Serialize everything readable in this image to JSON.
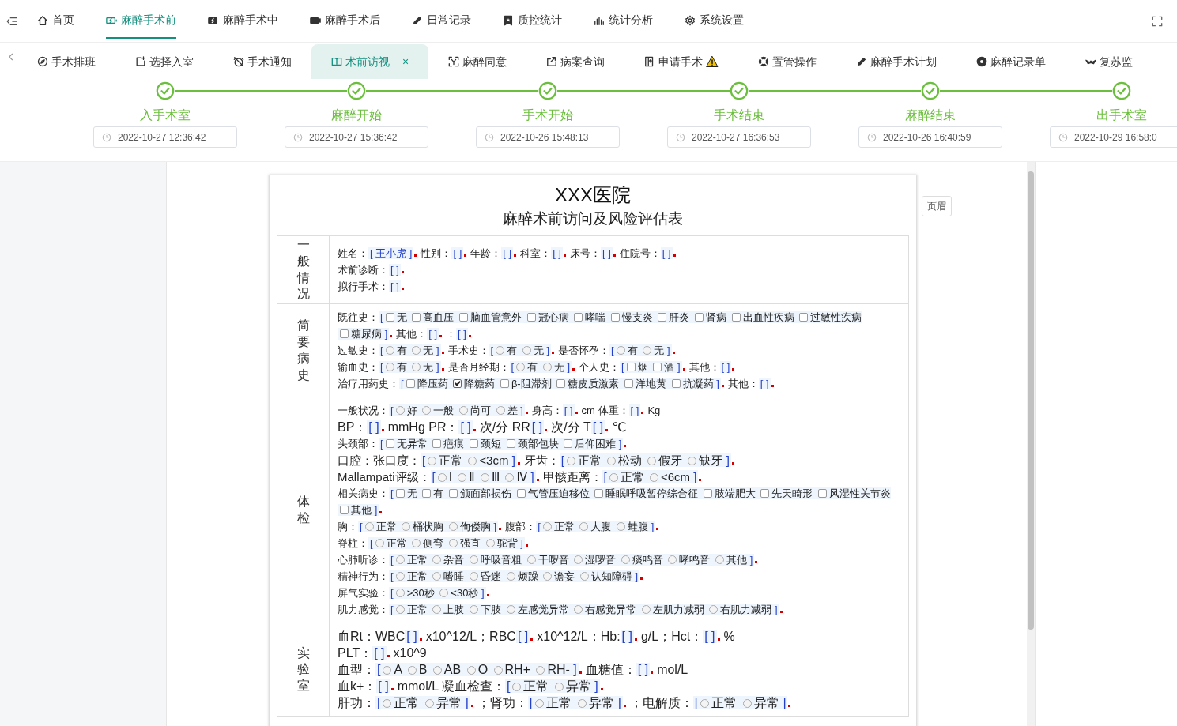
{
  "top_nav": [
    {
      "label": "首页",
      "selected": false
    },
    {
      "label": "麻醉手术前",
      "selected": true
    },
    {
      "label": "麻醉手术中",
      "selected": false
    },
    {
      "label": "麻醉手术后",
      "selected": false
    },
    {
      "label": "日常记录",
      "selected": false
    },
    {
      "label": "质控统计",
      "selected": false
    },
    {
      "label": "统计分析",
      "selected": false
    },
    {
      "label": "系统设置",
      "selected": false
    }
  ],
  "tabs": [
    {
      "label": "手术排班",
      "selected": false,
      "warning": false
    },
    {
      "label": "选择入室",
      "selected": false,
      "warning": false
    },
    {
      "label": "手术通知",
      "selected": false,
      "warning": false
    },
    {
      "label": "术前访视",
      "selected": true,
      "warning": false,
      "close": "×"
    },
    {
      "label": "麻醉同意",
      "selected": false,
      "warning": false
    },
    {
      "label": "病案查询",
      "selected": false,
      "warning": false
    },
    {
      "label": "申请手术",
      "selected": false,
      "warning": true
    },
    {
      "label": "置管操作",
      "selected": false,
      "warning": false
    },
    {
      "label": "麻醉手术计划",
      "selected": false,
      "warning": false
    },
    {
      "label": "麻醉记录单",
      "selected": false,
      "warning": false
    },
    {
      "label": "复苏监",
      "selected": false,
      "warning": false
    }
  ],
  "steps": [
    {
      "label": "入手术室",
      "done": true,
      "time": "2022-10-27 12:36:42"
    },
    {
      "label": "麻醉开始",
      "done": true,
      "time": "2022-10-27 15:36:42"
    },
    {
      "label": "手术开始",
      "done": true,
      "time": "2022-10-26 15:48:13"
    },
    {
      "label": "手术结束",
      "done": true,
      "time": "2022-10-27 16:36:53"
    },
    {
      "label": "麻醉结束",
      "done": true,
      "time": "2022-10-26 16:40:59"
    },
    {
      "label": "出手术室",
      "done": true,
      "time": "2022-10-29 16:58:0"
    }
  ],
  "document": {
    "hospital": "XXX医院",
    "title": "麻醉术前访问及风险评估表",
    "header_button": "页眉",
    "sections": [
      {
        "title": "一般情况",
        "lines": [
          {
            "kind": "small",
            "parts": [
              {
                "kind": "text",
                "text": "姓名："
              },
              {
                "kind": "field",
                "open": "[",
                "value": "王小虎",
                "close": "]"
              },
              {
                "kind": "text",
                "text": "性别："
              },
              {
                "kind": "field",
                "open": "[",
                "close": "]"
              },
              {
                "kind": "text",
                "text": "年龄："
              },
              {
                "kind": "field",
                "open": "[",
                "close": "]"
              },
              {
                "kind": "text",
                "text": "科室："
              },
              {
                "kind": "field",
                "open": "[",
                "close": "]"
              },
              {
                "kind": "text",
                "text": "床号："
              },
              {
                "kind": "field",
                "open": "[",
                "close": "]"
              },
              {
                "kind": "text",
                "text": "住院号："
              },
              {
                "kind": "field",
                "open": "[",
                "close": "]"
              }
            ]
          },
          {
            "kind": "small",
            "parts": [
              {
                "kind": "text",
                "text": "术前诊断："
              },
              {
                "kind": "field",
                "open": "[",
                "close": "]"
              }
            ]
          },
          {
            "kind": "small",
            "parts": [
              {
                "kind": "text",
                "text": "拟行手术："
              },
              {
                "kind": "field",
                "open": "[",
                "close": "]"
              }
            ]
          }
        ]
      },
      {
        "title": "简要病史",
        "lines": [
          {
            "kind": "small",
            "parts": [
              {
                "kind": "text",
                "text": "既往史："
              },
              {
                "kind": "checks",
                "open": "[",
                "close": "]",
                "options": [
                  {
                    "label": "无",
                    "checked": false
                  },
                  {
                    "label": "高血压",
                    "checked": false
                  },
                  {
                    "label": "脑血管意外",
                    "checked": false
                  },
                  {
                    "label": "冠心病",
                    "checked": false
                  },
                  {
                    "label": "哮喘",
                    "checked": false
                  },
                  {
                    "label": "慢支炎",
                    "checked": false
                  },
                  {
                    "label": "肝炎",
                    "checked": false
                  },
                  {
                    "label": "肾病",
                    "checked": false
                  },
                  {
                    "label": "出血性疾病",
                    "checked": false
                  },
                  {
                    "label": "过敏性疾病",
                    "checked": false
                  },
                  {
                    "label": "糖尿病",
                    "checked": false
                  }
                ]
              },
              {
                "kind": "text",
                "text": "其他："
              },
              {
                "kind": "field",
                "open": "[",
                "close": "]"
              },
              {
                "kind": "text",
                "text": "："
              },
              {
                "kind": "field",
                "open": "[",
                "close": "]"
              }
            ]
          },
          {
            "kind": "small",
            "parts": [
              {
                "kind": "text",
                "text": "过敏史："
              },
              {
                "kind": "radios",
                "open": "[",
                "close": "]",
                "options": [
                  {
                    "label": "有",
                    "selected": false
                  },
                  {
                    "label": "无",
                    "selected": false
                  }
                ]
              },
              {
                "kind": "text",
                "text": "手术史："
              },
              {
                "kind": "radios",
                "open": "[",
                "close": "]",
                "options": [
                  {
                    "label": "有",
                    "selected": false
                  },
                  {
                    "label": "无",
                    "selected": false
                  }
                ]
              },
              {
                "kind": "text",
                "text": "是否怀孕："
              },
              {
                "kind": "radios",
                "open": "[",
                "close": "]",
                "options": [
                  {
                    "label": "有",
                    "selected": false
                  },
                  {
                    "label": "无",
                    "selected": false
                  }
                ]
              }
            ]
          },
          {
            "kind": "small",
            "parts": [
              {
                "kind": "text",
                "text": "输血史："
              },
              {
                "kind": "radios",
                "open": "[",
                "close": "]",
                "options": [
                  {
                    "label": "有",
                    "selected": false
                  },
                  {
                    "label": "无",
                    "selected": false
                  }
                ]
              },
              {
                "kind": "text",
                "text": "是否月经期："
              },
              {
                "kind": "radios",
                "open": "[",
                "close": "]",
                "options": [
                  {
                    "label": "有",
                    "selected": false
                  },
                  {
                    "label": "无",
                    "selected": false
                  }
                ]
              },
              {
                "kind": "text",
                "text": "个人史："
              },
              {
                "kind": "checks",
                "open": "[",
                "close": "]",
                "options": [
                  {
                    "label": "烟",
                    "checked": false
                  },
                  {
                    "label": "酒",
                    "checked": false
                  }
                ]
              },
              {
                "kind": "text",
                "text": "其他："
              },
              {
                "kind": "field",
                "open": "[",
                "close": "]"
              }
            ]
          },
          {
            "kind": "small",
            "parts": [
              {
                "kind": "text",
                "text": "治疗用药史："
              },
              {
                "kind": "checks",
                "open": "[",
                "close": "]",
                "options": [
                  {
                    "label": "降压药",
                    "checked": false
                  },
                  {
                    "label": "降糖药",
                    "checked": true
                  },
                  {
                    "label": "β-阻滞剂",
                    "checked": false
                  },
                  {
                    "label": "糖皮质激素",
                    "checked": false
                  },
                  {
                    "label": "洋地黄",
                    "checked": false
                  },
                  {
                    "label": "抗凝药",
                    "checked": false
                  }
                ]
              },
              {
                "kind": "text",
                "text": "其他："
              },
              {
                "kind": "field",
                "open": "[",
                "close": "]"
              }
            ]
          }
        ]
      },
      {
        "title": "体检",
        "lines": [
          {
            "kind": "small",
            "parts": [
              {
                "kind": "text",
                "text": "一般状况："
              },
              {
                "kind": "radios",
                "open": "[",
                "close": "]",
                "options": [
                  {
                    "label": "好",
                    "selected": false
                  },
                  {
                    "label": "一般",
                    "selected": false
                  },
                  {
                    "label": "尚可",
                    "selected": false
                  },
                  {
                    "label": "差",
                    "selected": false
                  }
                ]
              },
              {
                "kind": "text",
                "text": "身高："
              },
              {
                "kind": "field",
                "open": "[",
                "close": "]"
              },
              {
                "kind": "text",
                "text": "cm 体重："
              },
              {
                "kind": "field",
                "open": "[",
                "close": "]"
              },
              {
                "kind": "text",
                "text": "Kg"
              }
            ]
          },
          {
            "kind": "large",
            "parts": [
              {
                "kind": "text",
                "text": "BP："
              },
              {
                "kind": "field",
                "open": "[",
                "close": "]"
              },
              {
                "kind": "text",
                "text": "mmHg PR："
              },
              {
                "kind": "field",
                "open": "[",
                "close": "]"
              },
              {
                "kind": "text",
                "text": "次/分 RR"
              },
              {
                "kind": "field",
                "open": "[",
                "close": "]"
              },
              {
                "kind": "text",
                "text": "次/分 T"
              },
              {
                "kind": "field",
                "open": "[",
                "close": "]"
              },
              {
                "kind": "text",
                "text": "℃"
              }
            ]
          },
          {
            "kind": "small",
            "parts": [
              {
                "kind": "text",
                "text": "头颈部："
              },
              {
                "kind": "checks",
                "open": "[",
                "close": "]",
                "options": [
                  {
                    "label": "无异常",
                    "checked": false
                  },
                  {
                    "label": "疤痕",
                    "checked": false
                  },
                  {
                    "label": "颈短",
                    "checked": false
                  },
                  {
                    "label": "颈部包块",
                    "checked": false
                  },
                  {
                    "label": "后仰困难",
                    "checked": false
                  }
                ]
              }
            ]
          },
          {
            "kind": "medium",
            "parts": [
              {
                "kind": "text",
                "text": "口腔：张口度："
              },
              {
                "kind": "radios",
                "open": "[",
                "close": "]",
                "options": [
                  {
                    "label": "正常",
                    "selected": false
                  },
                  {
                    "label": "<3cm",
                    "selected": false
                  }
                ]
              },
              {
                "kind": "text",
                "text": "牙齿："
              },
              {
                "kind": "radios",
                "open": "[",
                "close": "]",
                "options": [
                  {
                    "label": "正常",
                    "selected": false
                  },
                  {
                    "label": "松动",
                    "selected": false
                  },
                  {
                    "label": "假牙",
                    "selected": false
                  },
                  {
                    "label": "缺牙",
                    "selected": false
                  }
                ]
              }
            ]
          },
          {
            "kind": "medium",
            "parts": [
              {
                "kind": "text",
                "text": "Mallampati评级："
              },
              {
                "kind": "radios",
                "open": "[",
                "close": "]",
                "options": [
                  {
                    "label": "Ⅰ",
                    "selected": false
                  },
                  {
                    "label": "Ⅱ",
                    "selected": false
                  },
                  {
                    "label": "Ⅲ",
                    "selected": false
                  },
                  {
                    "label": "Ⅳ",
                    "selected": false
                  }
                ]
              },
              {
                "kind": "text",
                "text": "甲骸距离："
              },
              {
                "kind": "radios",
                "open": "[",
                "close": "]",
                "options": [
                  {
                    "label": "正常",
                    "selected": false
                  },
                  {
                    "label": "<6cm",
                    "selected": false
                  }
                ]
              }
            ]
          },
          {
            "kind": "small",
            "parts": [
              {
                "kind": "text",
                "text": "相关病史："
              },
              {
                "kind": "checks",
                "open": "[",
                "close": "]",
                "options": [
                  {
                    "label": "无",
                    "checked": false
                  },
                  {
                    "label": "有",
                    "checked": false
                  },
                  {
                    "label": "颁面部损伤",
                    "checked": false
                  },
                  {
                    "label": "气管压迫移位",
                    "checked": false
                  },
                  {
                    "label": "睡眠呼吸暂停综合征",
                    "checked": false
                  },
                  {
                    "label": "肢端肥大",
                    "checked": false
                  },
                  {
                    "label": "先天畸形",
                    "checked": false
                  },
                  {
                    "label": "风湿性关节炎",
                    "checked": false
                  },
                  {
                    "label": "其他",
                    "checked": false
                  }
                ]
              }
            ]
          },
          {
            "kind": "small",
            "parts": [
              {
                "kind": "text",
                "text": "胸："
              },
              {
                "kind": "radios",
                "open": "[",
                "close": "]",
                "options": [
                  {
                    "label": "正常",
                    "selected": false
                  },
                  {
                    "label": "桶状胸",
                    "selected": false
                  },
                  {
                    "label": "佝偻胸",
                    "selected": false
                  }
                ]
              },
              {
                "kind": "text",
                "text": "腹部："
              },
              {
                "kind": "radios",
                "open": "[",
                "close": "]",
                "options": [
                  {
                    "label": "正常",
                    "selected": false
                  },
                  {
                    "label": "大腹",
                    "selected": false
                  },
                  {
                    "label": "蛙腹",
                    "selected": false
                  }
                ]
              }
            ]
          },
          {
            "kind": "small",
            "parts": [
              {
                "kind": "text",
                "text": "脊柱："
              },
              {
                "kind": "radios",
                "open": "[",
                "close": "]",
                "options": [
                  {
                    "label": "正常",
                    "selected": false
                  },
                  {
                    "label": "侧弯",
                    "selected": false
                  },
                  {
                    "label": "强直",
                    "selected": false
                  },
                  {
                    "label": "驼背",
                    "selected": false
                  }
                ]
              }
            ]
          },
          {
            "kind": "small",
            "parts": [
              {
                "kind": "text",
                "text": "心肺听诊："
              },
              {
                "kind": "radios",
                "open": "[",
                "close": "]",
                "options": [
                  {
                    "label": "正常",
                    "selected": false
                  },
                  {
                    "label": "杂音",
                    "selected": false
                  },
                  {
                    "label": "呼吸音粗",
                    "selected": false
                  },
                  {
                    "label": "干啰音",
                    "selected": false
                  },
                  {
                    "label": "湿啰音",
                    "selected": false
                  },
                  {
                    "label": "痰鸣音",
                    "selected": false
                  },
                  {
                    "label": "哮鸣音",
                    "selected": false
                  },
                  {
                    "label": "其他",
                    "selected": false
                  }
                ]
              }
            ]
          },
          {
            "kind": "small",
            "parts": [
              {
                "kind": "text",
                "text": "精神行为："
              },
              {
                "kind": "radios",
                "open": "[",
                "close": "]",
                "options": [
                  {
                    "label": "正常",
                    "selected": false
                  },
                  {
                    "label": "嗜睡",
                    "selected": false
                  },
                  {
                    "label": "昏迷",
                    "selected": false
                  },
                  {
                    "label": "烦躁",
                    "selected": false
                  },
                  {
                    "label": "谵妄",
                    "selected": false
                  },
                  {
                    "label": "认知障碍",
                    "selected": false
                  }
                ]
              }
            ]
          },
          {
            "kind": "small",
            "parts": [
              {
                "kind": "text",
                "text": "屏气实验："
              },
              {
                "kind": "radios",
                "open": "[",
                "close": "]",
                "options": [
                  {
                    "label": ">30秒",
                    "selected": false
                  },
                  {
                    "label": "<30秒",
                    "selected": false
                  }
                ]
              }
            ]
          },
          {
            "kind": "small",
            "parts": [
              {
                "kind": "text",
                "text": "肌力感觉："
              },
              {
                "kind": "radios",
                "open": "[",
                "close": "]",
                "options": [
                  {
                    "label": "正常",
                    "selected": false
                  },
                  {
                    "label": "上肢",
                    "selected": false
                  },
                  {
                    "label": "下肢",
                    "selected": false
                  },
                  {
                    "label": "左感觉异常",
                    "selected": false
                  },
                  {
                    "label": "右感觉异常",
                    "selected": false
                  },
                  {
                    "label": "左肌力减弱",
                    "selected": false
                  },
                  {
                    "label": "右肌力减弱",
                    "selected": false
                  }
                ]
              }
            ]
          }
        ]
      },
      {
        "title": "实验室",
        "lines": [
          {
            "kind": "large",
            "parts": [
              {
                "kind": "text",
                "text": "血Rt：WBC"
              },
              {
                "kind": "field",
                "open": "[",
                "close": "]"
              },
              {
                "kind": "text",
                "text": "x10^12/L；RBC"
              },
              {
                "kind": "field",
                "open": "[",
                "close": "]"
              },
              {
                "kind": "text",
                "text": "x10^12/L；Hb:"
              },
              {
                "kind": "field",
                "open": "[",
                "close": "]"
              },
              {
                "kind": "text",
                "text": "g/L；Hct："
              },
              {
                "kind": "field",
                "open": "[",
                "close": "]"
              },
              {
                "kind": "text",
                "text": "%"
              }
            ]
          },
          {
            "kind": "large",
            "parts": [
              {
                "kind": "text",
                "text": "PLT："
              },
              {
                "kind": "field",
                "open": "[",
                "close": "]"
              },
              {
                "kind": "text",
                "text": "x10^9"
              }
            ]
          },
          {
            "kind": "large",
            "parts": [
              {
                "kind": "text",
                "text": "血型："
              },
              {
                "kind": "radios",
                "open": "[",
                "close": "]",
                "options": [
                  {
                    "label": "A",
                    "selected": false
                  },
                  {
                    "label": "B",
                    "selected": false
                  },
                  {
                    "label": "AB",
                    "selected": false
                  },
                  {
                    "label": "O",
                    "selected": false
                  },
                  {
                    "label": "RH+",
                    "selected": false
                  },
                  {
                    "label": "RH-",
                    "selected": false
                  }
                ]
              },
              {
                "kind": "text",
                "text": "血糖值："
              },
              {
                "kind": "field",
                "open": "[",
                "close": "]"
              },
              {
                "kind": "text",
                "text": "mol/L"
              }
            ]
          },
          {
            "kind": "large",
            "parts": [
              {
                "kind": "text",
                "text": "血k+："
              },
              {
                "kind": "field",
                "open": "[",
                "close": "]"
              },
              {
                "kind": "text",
                "text": "mmol/L 凝血检查："
              },
              {
                "kind": "radios",
                "open": "[",
                "close": "]",
                "options": [
                  {
                    "label": "正常",
                    "selected": false
                  },
                  {
                    "label": "异常",
                    "selected": false
                  }
                ]
              }
            ]
          },
          {
            "kind": "large",
            "parts": [
              {
                "kind": "text",
                "text": "肝功："
              },
              {
                "kind": "radios",
                "open": "[",
                "close": "]",
                "options": [
                  {
                    "label": "正常",
                    "selected": false
                  },
                  {
                    "label": "异常",
                    "selected": false
                  }
                ]
              },
              {
                "kind": "text",
                "text": "；肾功："
              },
              {
                "kind": "radios",
                "open": "[",
                "close": "]",
                "options": [
                  {
                    "label": "正常",
                    "selected": false
                  },
                  {
                    "label": "异常",
                    "selected": false
                  }
                ]
              },
              {
                "kind": "text",
                "text": "；电解质："
              },
              {
                "kind": "radios",
                "open": "[",
                "close": "]",
                "options": [
                  {
                    "label": "正常",
                    "selected": false
                  },
                  {
                    "label": "异常",
                    "selected": false
                  }
                ]
              }
            ]
          }
        ]
      }
    ]
  }
}
